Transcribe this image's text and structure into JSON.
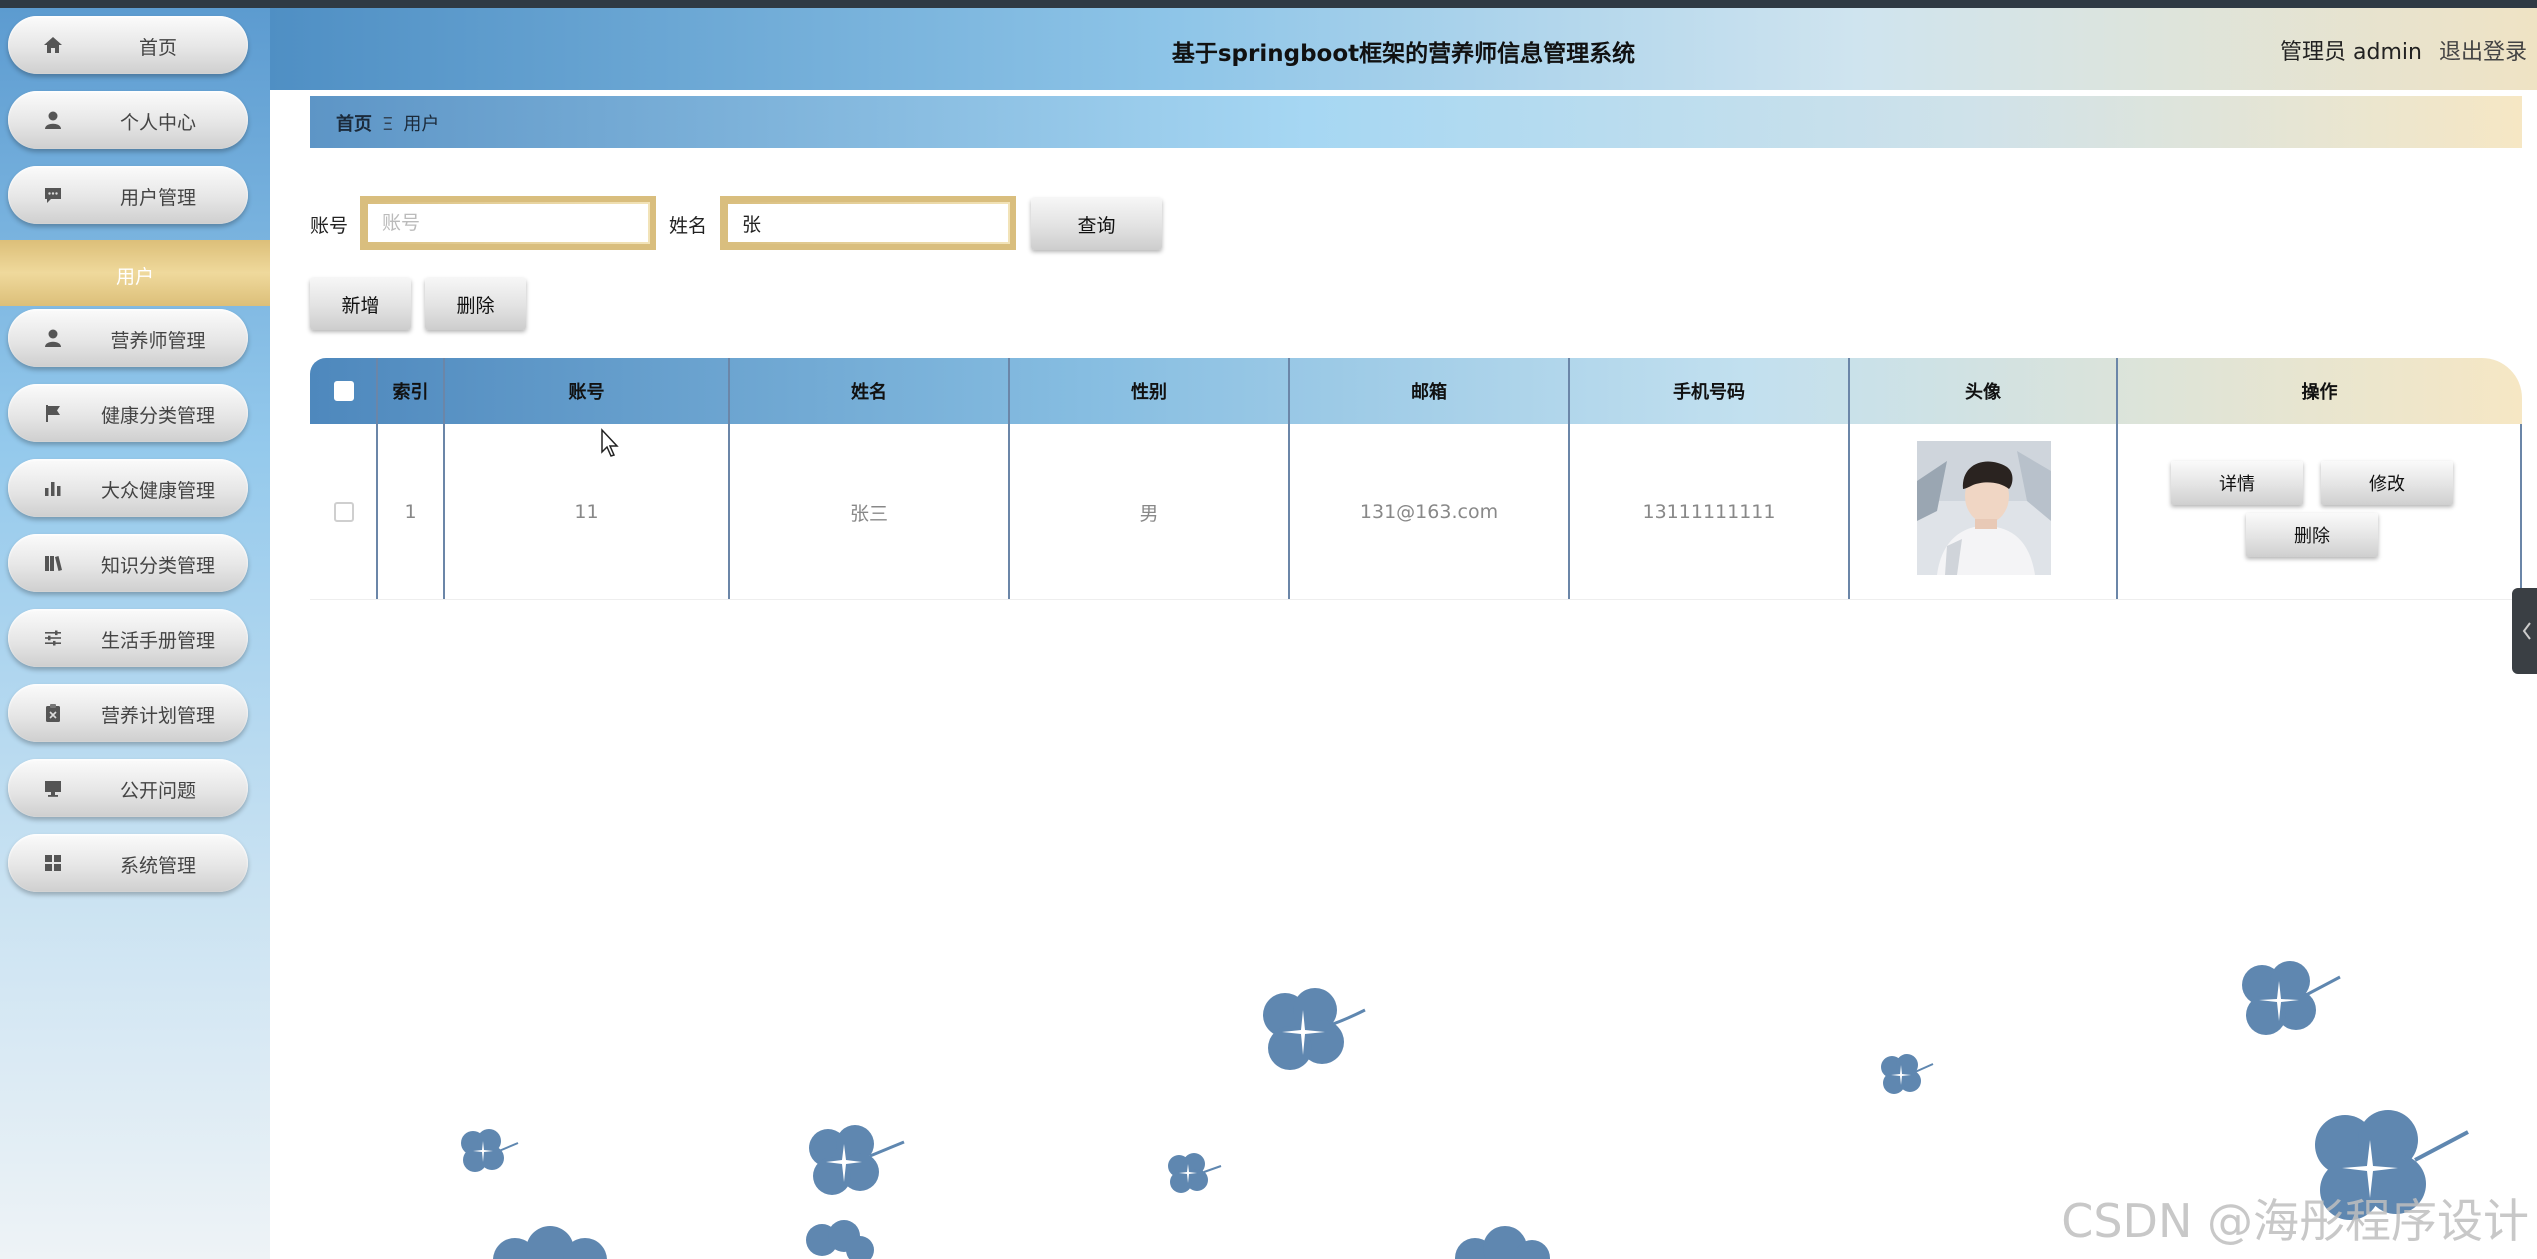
{
  "header": {
    "title": "基于springboot框架的营养师信息管理系统",
    "user_label": "管理员 admin",
    "logout_label": "退出登录"
  },
  "sidebar": {
    "items": [
      {
        "label": "首页",
        "icon": "home-icon"
      },
      {
        "label": "个人中心",
        "icon": "person-icon"
      },
      {
        "label": "用户管理",
        "icon": "chat-icon"
      },
      {
        "label": "营养师管理",
        "icon": "person-icon"
      },
      {
        "label": "健康分类管理",
        "icon": "flag-icon"
      },
      {
        "label": "大众健康管理",
        "icon": "bar-chart-icon"
      },
      {
        "label": "知识分类管理",
        "icon": "book-icon"
      },
      {
        "label": "生活手册管理",
        "icon": "sliders-icon"
      },
      {
        "label": "营养计划管理",
        "icon": "clipboard-icon"
      },
      {
        "label": "公开问题",
        "icon": "monitor-icon"
      },
      {
        "label": "系统管理",
        "icon": "grid-icon"
      }
    ],
    "active_sub": "用户"
  },
  "breadcrumb": {
    "home": "首页",
    "separator": "Ξ",
    "current": "用户"
  },
  "search": {
    "account_label": "账号",
    "account_placeholder": "账号",
    "account_value": "",
    "name_label": "姓名",
    "name_value": "张",
    "query_button": "查询"
  },
  "actions": {
    "add_button": "新增",
    "delete_button": "删除"
  },
  "table": {
    "headers": [
      "索引",
      "账号",
      "姓名",
      "性别",
      "邮箱",
      "手机号码",
      "头像",
      "操作"
    ],
    "rows": [
      {
        "index": "1",
        "account": "11",
        "name": "张三",
        "gender": "男",
        "email": "131@163.com",
        "phone": "13111111111",
        "buttons": {
          "detail": "详情",
          "edit": "修改",
          "delete": "删除"
        }
      }
    ]
  },
  "watermark": "CSDN @海彤程序设计",
  "colors": {
    "accent_gold": "#dcbf79",
    "header_blue": "#4f8fc4",
    "flower_blue": "#5f87b0"
  }
}
